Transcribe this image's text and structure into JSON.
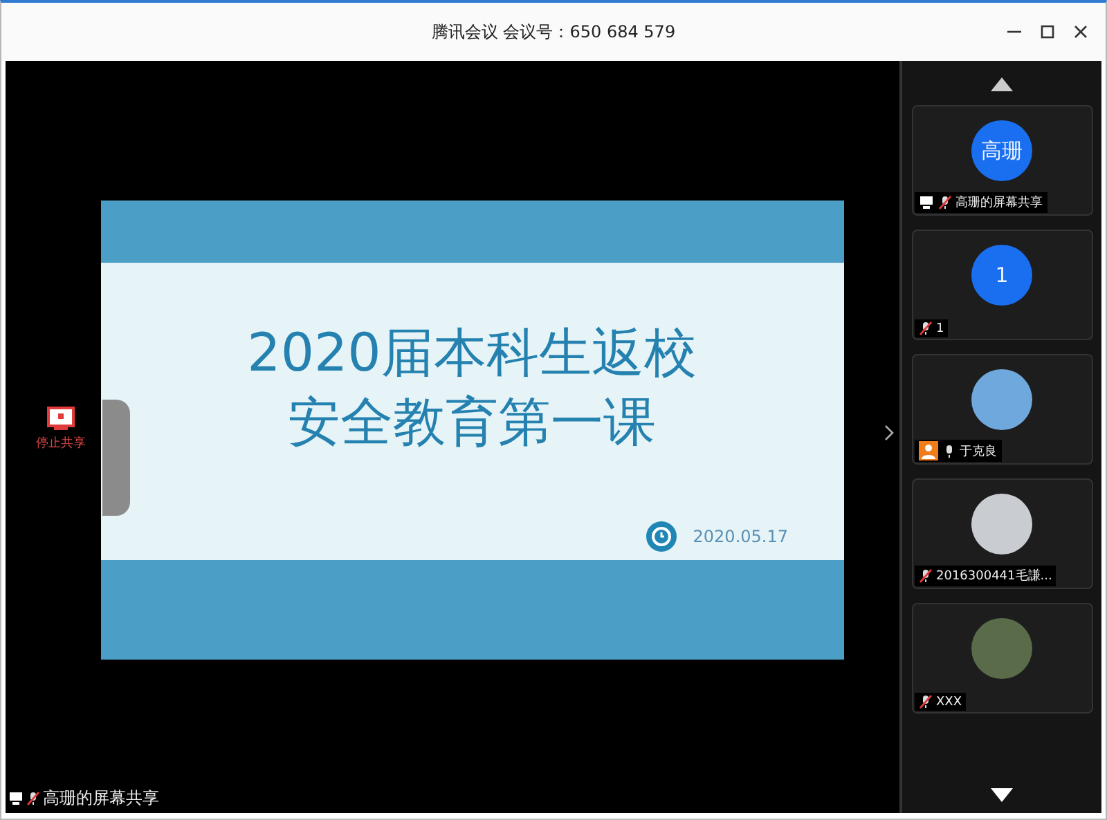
{
  "window": {
    "title": "腾讯会议 会议号：650 684 579"
  },
  "slide": {
    "title_lines": [
      "2020届本科生返校",
      "安全教育第一课"
    ],
    "date": "2020.05.17"
  },
  "stop_share": {
    "label": "停止共享"
  },
  "participants": [
    {
      "name": "高珊的屏幕共享",
      "kind": "initials",
      "avatar_text": "高珊",
      "sharing": true,
      "host": false,
      "muted": true
    },
    {
      "name": "1",
      "kind": "initials",
      "avatar_text": "1",
      "sharing": false,
      "host": false,
      "muted": true
    },
    {
      "name": "于克良",
      "kind": "photo",
      "sharing": false,
      "host": true,
      "muted": false
    },
    {
      "name": "2016300441毛謙...",
      "kind": "photo",
      "sharing": false,
      "host": false,
      "muted": true
    },
    {
      "name": "XXX",
      "kind": "photo",
      "sharing": false,
      "host": false,
      "muted": true
    }
  ],
  "share_caption": {
    "label": "高珊的屏幕共享",
    "sharing": true,
    "muted": true
  }
}
